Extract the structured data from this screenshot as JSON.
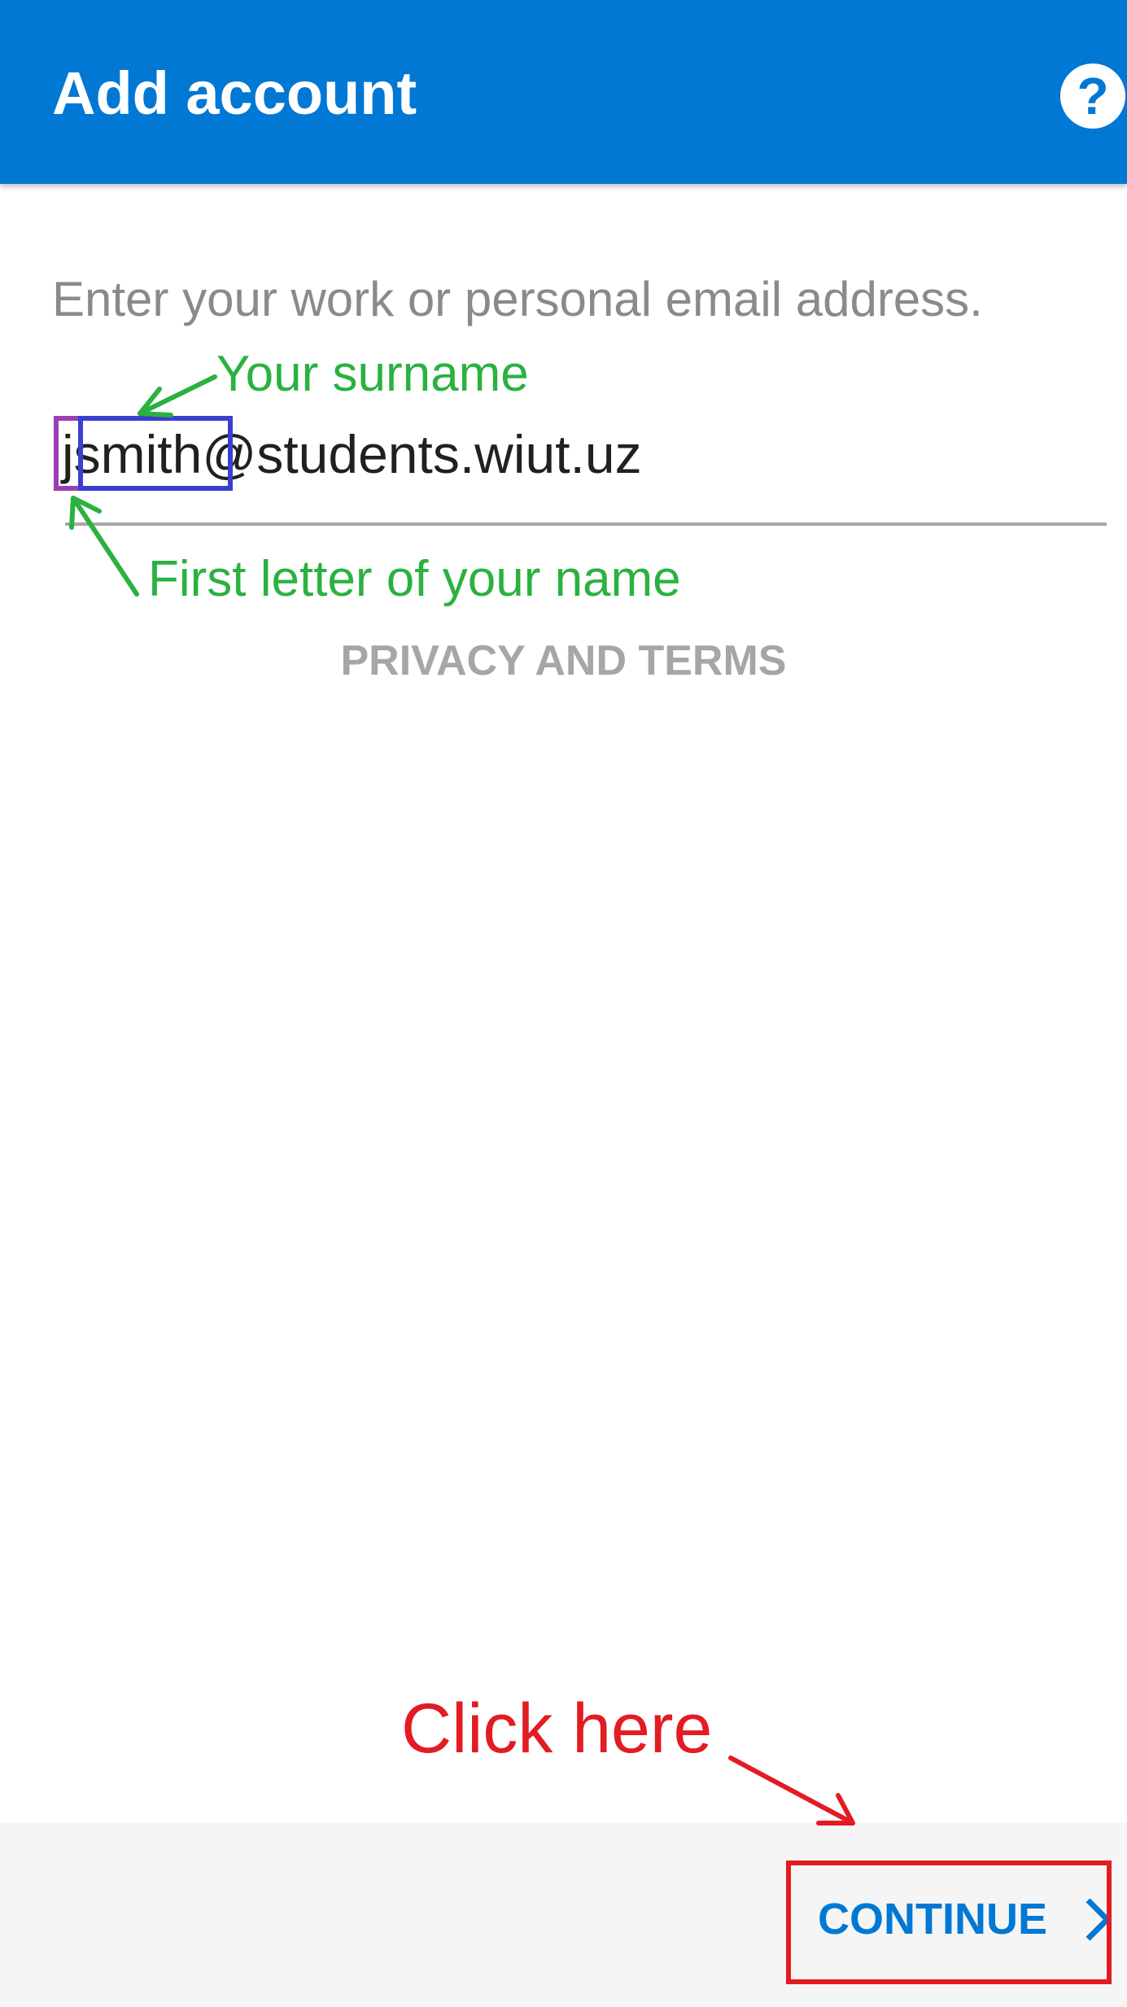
{
  "app_bar": {
    "title": "Add account",
    "help_glyph": "?",
    "help_icon": "help-icon",
    "background_color": "#0078d4"
  },
  "form": {
    "instruction": "Enter your work or personal email address.",
    "email_value": "jsmith@students.wiut.uz"
  },
  "links": {
    "privacy": "PRIVACY AND TERMS"
  },
  "footer": {
    "continue_label": "CONTINUE",
    "continue_icon": "chevron-right-icon"
  },
  "annotations": {
    "surname_label": "Your surname",
    "first_letter_label": "First letter of your name",
    "click_label": "Click here",
    "green_color": "#2bb140",
    "red_color": "#e31b23",
    "purple_color": "#9b3fb5",
    "blue_color": "#3b3fd0"
  }
}
